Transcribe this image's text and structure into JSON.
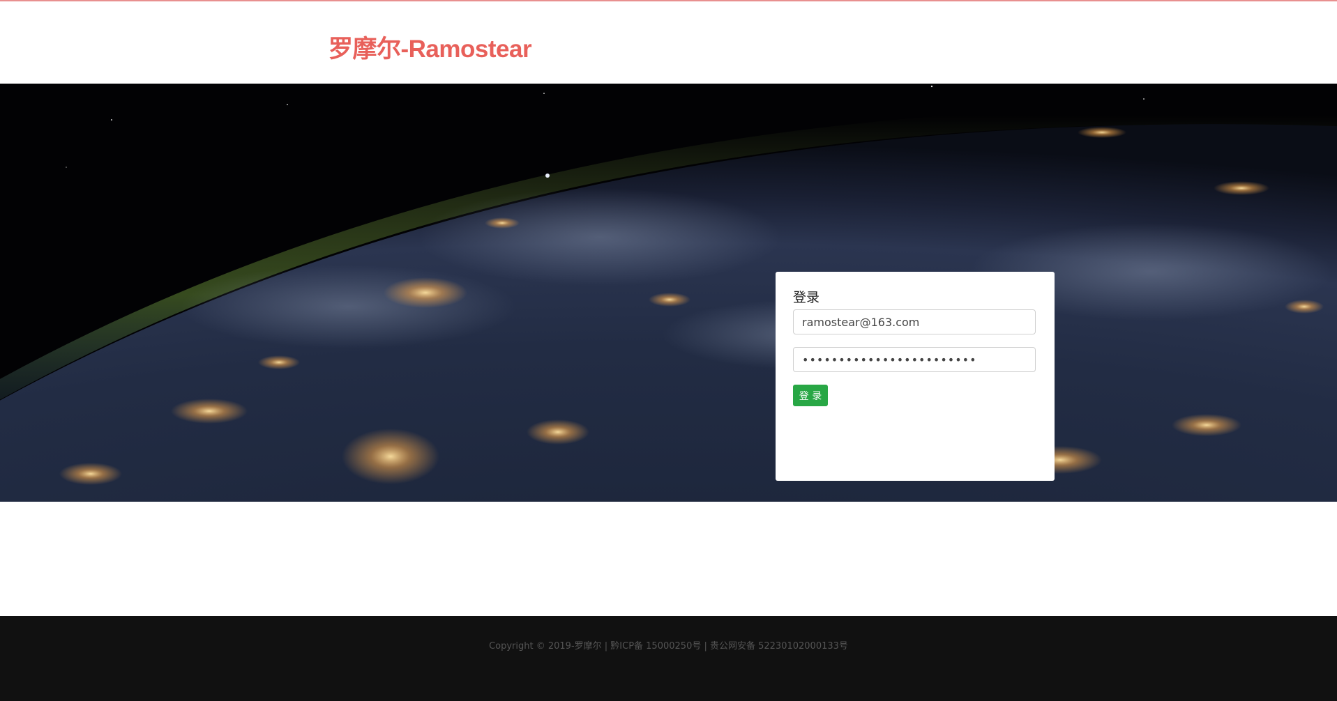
{
  "brand": {
    "title": "罗摩尔-Ramostear",
    "color": "#e8605a"
  },
  "hero": {
    "image": "earth-at-night-from-space"
  },
  "login": {
    "title": "登录",
    "email_value": "ramostear@163.com",
    "password_value": "••••••••••••••••••••••••",
    "button_label": "登 录",
    "button_color": "#28a745"
  },
  "footer": {
    "copyright": "Copyright © 2019-罗摩尔 | 黔ICP备 15000250号 | 贵公网安备 52230102000133号"
  }
}
